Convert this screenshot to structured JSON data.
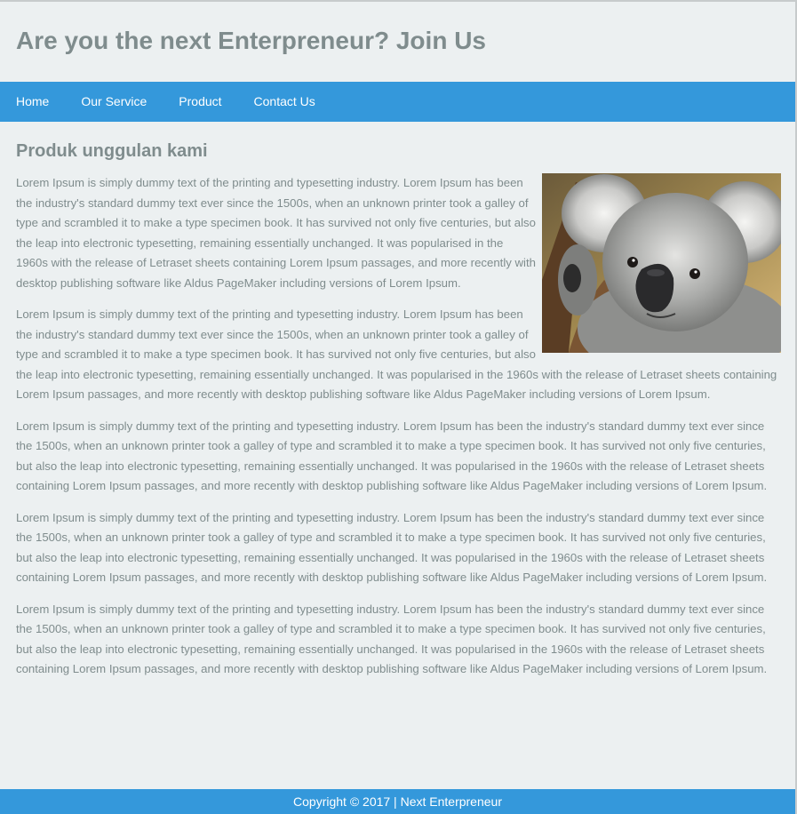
{
  "header": {
    "title": "Are you the next Enterpreneur? Join Us"
  },
  "nav": {
    "items": [
      {
        "label": "Home"
      },
      {
        "label": "Our Service"
      },
      {
        "label": "Product"
      },
      {
        "label": "Contact Us"
      }
    ]
  },
  "main": {
    "heading": "Produk unggulan kami",
    "image_alt": "koala",
    "paragraphs": [
      "Lorem Ipsum is simply dummy text of the printing and typesetting industry. Lorem Ipsum has been the industry's standard dummy text ever since the 1500s, when an unknown printer took a galley of type and scrambled it to make a type specimen book. It has survived not only five centuries, but also the leap into electronic typesetting, remaining essentially unchanged. It was popularised in the 1960s with the release of Letraset sheets containing Lorem Ipsum passages, and more recently with desktop publishing software like Aldus PageMaker including versions of Lorem Ipsum.",
      "Lorem Ipsum is simply dummy text of the printing and typesetting industry. Lorem Ipsum has been the industry's standard dummy text ever since the 1500s, when an unknown printer took a galley of type and scrambled it to make a type specimen book. It has survived not only five centuries, but also the leap into electronic typesetting, remaining essentially unchanged. It was popularised in the 1960s with the release of Letraset sheets containing Lorem Ipsum passages, and more recently with desktop publishing software like Aldus PageMaker including versions of Lorem Ipsum.",
      "Lorem Ipsum is simply dummy text of the printing and typesetting industry. Lorem Ipsum has been the industry's standard dummy text ever since the 1500s, when an unknown printer took a galley of type and scrambled it to make a type specimen book. It has survived not only five centuries, but also the leap into electronic typesetting, remaining essentially unchanged. It was popularised in the 1960s with the release of Letraset sheets containing Lorem Ipsum passages, and more recently with desktop publishing software like Aldus PageMaker including versions of Lorem Ipsum.",
      "Lorem Ipsum is simply dummy text of the printing and typesetting industry. Lorem Ipsum has been the industry's standard dummy text ever since the 1500s, when an unknown printer took a galley of type and scrambled it to make a type specimen book. It has survived not only five centuries, but also the leap into electronic typesetting, remaining essentially unchanged. It was popularised in the 1960s with the release of Letraset sheets containing Lorem Ipsum passages, and more recently with desktop publishing software like Aldus PageMaker including versions of Lorem Ipsum.",
      "Lorem Ipsum is simply dummy text of the printing and typesetting industry. Lorem Ipsum has been the industry's standard dummy text ever since the 1500s, when an unknown printer took a galley of type and scrambled it to make a type specimen book. It has survived not only five centuries, but also the leap into electronic typesetting, remaining essentially unchanged. It was popularised in the 1960s with the release of Letraset sheets containing Lorem Ipsum passages, and more recently with desktop publishing software like Aldus PageMaker including versions of Lorem Ipsum."
    ]
  },
  "footer": {
    "copyright": "Copyright © 2017 | Next Enterpreneur"
  },
  "colors": {
    "accent": "#3498db",
    "background": "#ecf0f1",
    "text": "#7f8c8d",
    "nav_text": "#ffffff"
  }
}
